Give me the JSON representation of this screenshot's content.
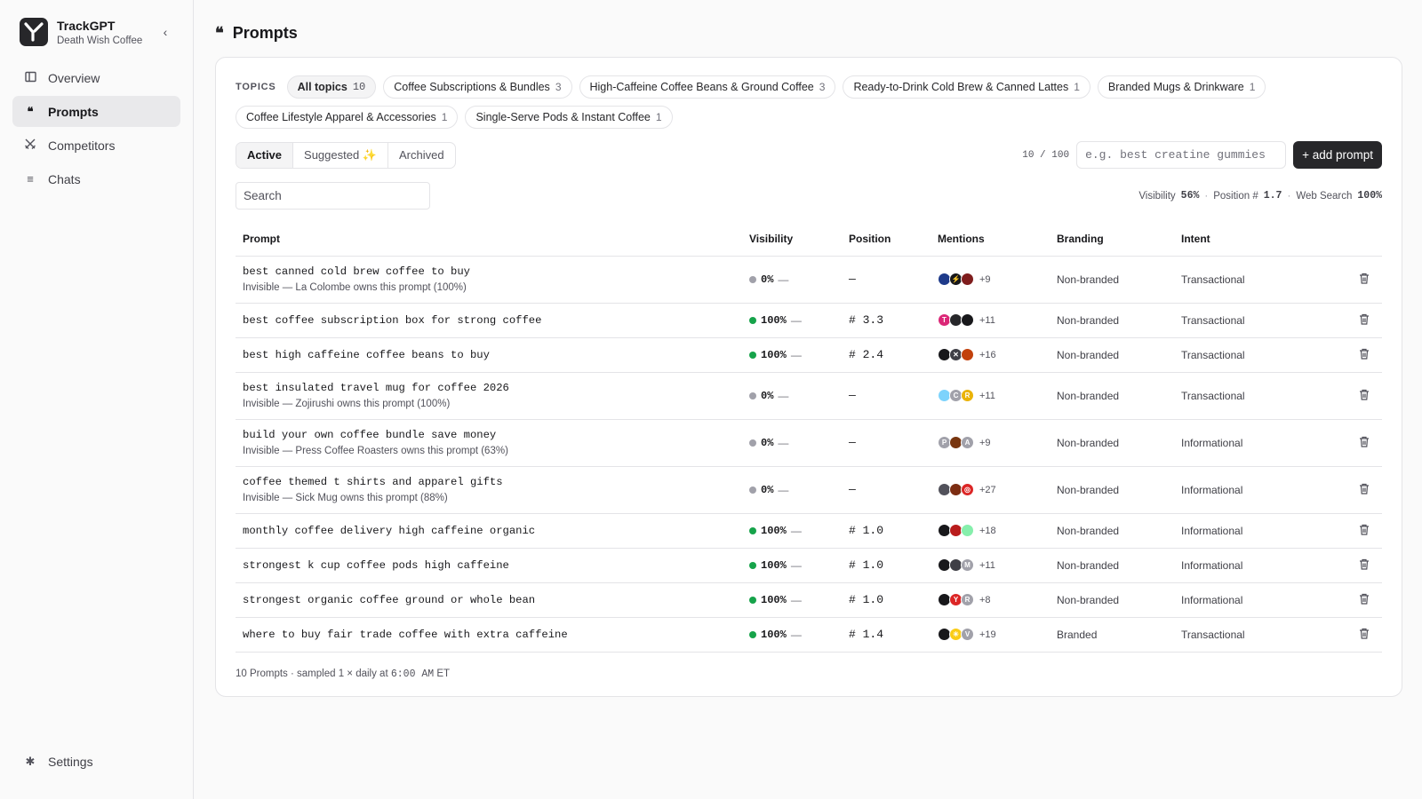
{
  "brand": {
    "name": "TrackGPT",
    "subtitle": "Death Wish Coffee"
  },
  "nav": {
    "items": [
      {
        "label": "Overview",
        "icon": "overview-icon"
      },
      {
        "label": "Prompts",
        "icon": "quote-icon"
      },
      {
        "label": "Competitors",
        "icon": "swords-icon"
      },
      {
        "label": "Chats",
        "icon": "list-icon"
      }
    ],
    "settings": "Settings"
  },
  "page": {
    "title": "Prompts"
  },
  "topics": {
    "label": "TOPICS",
    "chips": [
      {
        "label": "All topics",
        "count": "10"
      },
      {
        "label": "Coffee Subscriptions & Bundles",
        "count": "3"
      },
      {
        "label": "High-Caffeine Coffee Beans & Ground Coffee",
        "count": "3"
      },
      {
        "label": "Ready-to-Drink Cold Brew & Canned Lattes",
        "count": "1"
      },
      {
        "label": "Branded Mugs & Drinkware",
        "count": "1"
      },
      {
        "label": "Coffee Lifestyle Apparel & Accessories",
        "count": "1"
      },
      {
        "label": "Single-Serve Pods & Instant Coffee",
        "count": "1"
      }
    ]
  },
  "tabs": {
    "active": "Active",
    "suggested": "Suggested ✨",
    "archived": "Archived"
  },
  "add": {
    "counter": "10 / 100",
    "placeholder": "e.g. best creatine gummies",
    "button": "+ add prompt"
  },
  "search": {
    "placeholder": "Search"
  },
  "metrics": {
    "visibility_label": "Visibility",
    "visibility": "56%",
    "position_label": "Position #",
    "position": "1.7",
    "web_label": "Web Search",
    "web": "100%"
  },
  "table": {
    "headers": [
      "Prompt",
      "Visibility",
      "Position",
      "Mentions",
      "Branding",
      "Intent"
    ],
    "rows": [
      {
        "prompt": "best canned cold brew coffee to buy",
        "sub": "Invisible — La Colombe owns this prompt (100%)",
        "visibility": "0%",
        "vis_color": "gray",
        "position": "—",
        "more": "+9",
        "branding": "Non-branded",
        "intent": "Transactional",
        "avatars": [
          {
            "t": "",
            "c": "#1e3a8a"
          },
          {
            "t": "⚡",
            "c": "#18181b"
          },
          {
            "t": "",
            "c": "#7f1d1d"
          }
        ]
      },
      {
        "prompt": "best coffee subscription box for strong coffee",
        "sub": "",
        "visibility": "100%",
        "vis_color": "green",
        "position": "# 3.3",
        "more": "+11",
        "branding": "Non-branded",
        "intent": "Transactional",
        "avatars": [
          {
            "t": "T",
            "c": "#db2777"
          },
          {
            "t": "",
            "c": "#27272a"
          },
          {
            "t": "",
            "c": "#18181b"
          }
        ]
      },
      {
        "prompt": "best high caffeine coffee beans to buy",
        "sub": "",
        "visibility": "100%",
        "vis_color": "green",
        "position": "# 2.4",
        "more": "+16",
        "branding": "Non-branded",
        "intent": "Transactional",
        "avatars": [
          {
            "t": "",
            "c": "#18181b"
          },
          {
            "t": "✕",
            "c": "#3f3f46"
          },
          {
            "t": "",
            "c": "#c2410c"
          }
        ]
      },
      {
        "prompt": "best insulated travel mug for coffee 2026",
        "sub": "Invisible — Zojirushi owns this prompt (100%)",
        "visibility": "0%",
        "vis_color": "gray",
        "position": "—",
        "more": "+11",
        "branding": "Non-branded",
        "intent": "Transactional",
        "avatars": [
          {
            "t": "",
            "c": "#7dd3fc"
          },
          {
            "t": "C",
            "c": "#a1a1aa"
          },
          {
            "t": "R",
            "c": "#eab308"
          }
        ]
      },
      {
        "prompt": "build your own coffee bundle save money",
        "sub": "Invisible — Press Coffee Roasters owns this prompt (63%)",
        "visibility": "0%",
        "vis_color": "gray",
        "position": "—",
        "more": "+9",
        "branding": "Non-branded",
        "intent": "Informational",
        "avatars": [
          {
            "t": "P",
            "c": "#a1a1aa"
          },
          {
            "t": "",
            "c": "#78350f"
          },
          {
            "t": "A",
            "c": "#a1a1aa"
          }
        ]
      },
      {
        "prompt": "coffee themed t shirts and apparel gifts",
        "sub": "Invisible — Sick Mug owns this prompt (88%)",
        "visibility": "0%",
        "vis_color": "gray",
        "position": "—",
        "more": "+27",
        "branding": "Non-branded",
        "intent": "Informational",
        "avatars": [
          {
            "t": "",
            "c": "#52525b"
          },
          {
            "t": "",
            "c": "#7c2d12"
          },
          {
            "t": "◎",
            "c": "#dc2626"
          }
        ]
      },
      {
        "prompt": "monthly coffee delivery high caffeine organic",
        "sub": "",
        "visibility": "100%",
        "vis_color": "green",
        "position": "# 1.0",
        "more": "+18",
        "branding": "Non-branded",
        "intent": "Informational",
        "avatars": [
          {
            "t": "",
            "c": "#18181b"
          },
          {
            "t": "",
            "c": "#b91c1c"
          },
          {
            "t": "",
            "c": "#86efac"
          }
        ]
      },
      {
        "prompt": "strongest k cup coffee pods high caffeine",
        "sub": "",
        "visibility": "100%",
        "vis_color": "green",
        "position": "# 1.0",
        "more": "+11",
        "branding": "Non-branded",
        "intent": "Informational",
        "avatars": [
          {
            "t": "",
            "c": "#18181b"
          },
          {
            "t": "",
            "c": "#3f3f46"
          },
          {
            "t": "M",
            "c": "#a1a1aa"
          }
        ]
      },
      {
        "prompt": "strongest organic coffee ground or whole bean",
        "sub": "",
        "visibility": "100%",
        "vis_color": "green",
        "position": "# 1.0",
        "more": "+8",
        "branding": "Non-branded",
        "intent": "Informational",
        "avatars": [
          {
            "t": "",
            "c": "#18181b"
          },
          {
            "t": "Y",
            "c": "#dc2626"
          },
          {
            "t": "R",
            "c": "#a1a1aa"
          }
        ]
      },
      {
        "prompt": "where to buy fair trade coffee with extra caffeine",
        "sub": "",
        "visibility": "100%",
        "vis_color": "green",
        "position": "# 1.4",
        "more": "+19",
        "branding": "Branded",
        "intent": "Transactional",
        "avatars": [
          {
            "t": "",
            "c": "#18181b"
          },
          {
            "t": "✳",
            "c": "#facc15"
          },
          {
            "t": "V",
            "c": "#a1a1aa"
          }
        ]
      }
    ]
  },
  "footer": {
    "count": "10 Prompts",
    "sampled": "· sampled 1 × daily at",
    "time": "6:00 AM",
    "tz": "ET"
  },
  "colors": {
    "accent": "#27272a",
    "green": "#16a34a",
    "gray": "#a1a1aa"
  }
}
